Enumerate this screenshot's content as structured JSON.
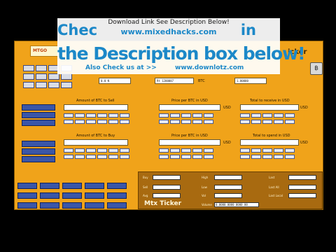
{
  "banner": {
    "top_line": "Download Link See Description Below!",
    "url": "www.mixedhacks.com",
    "check_left": "Chec",
    "check_right": "in",
    "description_line": "the Description box below!",
    "also_check": "Also Check us at >>",
    "also_url": "www.downlotz.com"
  },
  "app": {
    "logo_text": "MTGO",
    "title_suffix": "icker",
    "header_fields": [
      "0.0 N",
      "Rt 1200087",
      "1.00000"
    ],
    "header_label_btc": "BTC",
    "sell_section": {
      "amount_label": "Amount of BTC to Sell",
      "price_label": "Price per BTC in USD",
      "price_unit": "USD",
      "total_label": "Total to receive in USD",
      "total_unit": "USD"
    },
    "buy_section": {
      "amount_label": "Amount of BTC to Buy",
      "price_label": "Price per BTC in USD",
      "price_unit": "USD",
      "total_label": "Total to spend in USD",
      "total_unit": "USD"
    }
  },
  "mini_ticker": {
    "title": "Mtx Ticker",
    "labels": [
      "Buy",
      "High",
      "Last",
      "Sell",
      "Low",
      "Last All",
      "Avg",
      "Vol",
      "Last Local"
    ],
    "volume_label": "Volume",
    "volume_value": "0.0000 0000 0000 00"
  },
  "colors": {
    "app_bg": "#f0a31a",
    "banner_text": "#1c88c8",
    "button_blue": "#3a56a8"
  }
}
